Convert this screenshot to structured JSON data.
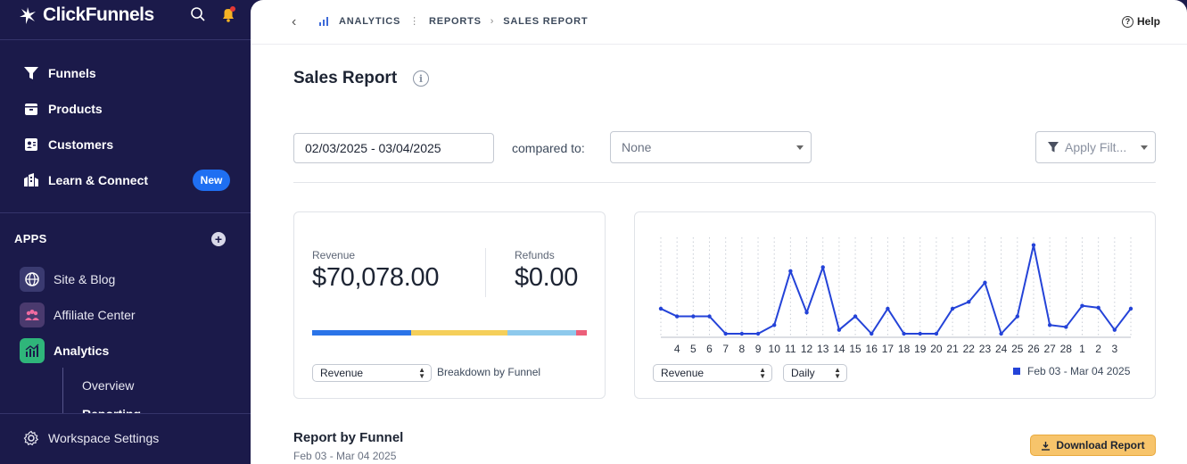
{
  "brand": {
    "name": "ClickFunnels"
  },
  "sidebar": {
    "nav": [
      {
        "label": "Funnels",
        "icon": "funnel-icon"
      },
      {
        "label": "Products",
        "icon": "box-icon"
      },
      {
        "label": "Customers",
        "icon": "contact-card-icon"
      },
      {
        "label": "Learn & Connect",
        "icon": "building-icon",
        "badge": "New"
      }
    ],
    "apps_label": "APPS",
    "apps": [
      {
        "label": "Site & Blog",
        "icon": "globe-icon",
        "color": "#3a3a70"
      },
      {
        "label": "Affiliate Center",
        "icon": "people-icon",
        "color": "#4a3a6e"
      },
      {
        "label": "Analytics",
        "icon": "chart-icon",
        "color": "#2fb57a"
      }
    ],
    "sub_items": [
      "Overview",
      "Reporting"
    ],
    "workspace_settings": "Workspace Settings"
  },
  "breadcrumb": {
    "items": [
      "ANALYTICS",
      "REPORTS",
      "SALES REPORT"
    ]
  },
  "help_label": "Help",
  "page_title": "Sales Report",
  "filters": {
    "date_range": "02/03/2025 - 03/04/2025",
    "compared_label": "compared to:",
    "compared_value": "None",
    "apply_filters": "Apply Filt..."
  },
  "summary": {
    "revenue_label": "Revenue",
    "revenue_value": "$70,078.00",
    "refunds_label": "Refunds",
    "refunds_value": "$0.00",
    "metric_select": "Revenue",
    "breakdown_label": "Breakdown by Funnel",
    "breakdown_bar": [
      {
        "share": 0.36,
        "color": "#2b74e8"
      },
      {
        "share": 0.35,
        "color": "#f5cf5a"
      },
      {
        "share": 0.25,
        "color": "#8ec9ec"
      },
      {
        "share": 0.04,
        "color": "#ec5f7a"
      }
    ]
  },
  "chart_data": {
    "type": "line",
    "x": [
      "3",
      "4",
      "5",
      "6",
      "7",
      "8",
      "9",
      "10",
      "11",
      "12",
      "13",
      "14",
      "15",
      "16",
      "17",
      "18",
      "19",
      "20",
      "21",
      "22",
      "23",
      "24",
      "25",
      "26",
      "27",
      "28",
      "1",
      "2",
      "3",
      "4"
    ],
    "tick_labels": [
      "",
      "4",
      "5",
      "6",
      "7",
      "8",
      "9",
      "10",
      "11",
      "12",
      "13",
      "14",
      "15",
      "16",
      "17",
      "18",
      "19",
      "20",
      "21",
      "22",
      "23",
      "24",
      "25",
      "26",
      "27",
      "28",
      "1",
      "2",
      "3",
      ""
    ],
    "series": [
      {
        "values": [
          0.26,
          0.18,
          0.18,
          0.18,
          0.0,
          0.0,
          0.0,
          0.09,
          0.65,
          0.22,
          0.69,
          0.04,
          0.18,
          0.0,
          0.26,
          0.0,
          0.0,
          0.0,
          0.26,
          0.33,
          0.53,
          0.0,
          0.18,
          0.92,
          0.09,
          0.07,
          0.29,
          0.27,
          0.04,
          0.26
        ],
        "color": "#2443d8"
      }
    ],
    "metric_select": "Revenue",
    "interval_select": "Daily",
    "legend": "Feb 03 - Mar 04 2025",
    "grid": "vertical dotted"
  },
  "report_by_funnel": {
    "title": "Report by Funnel",
    "subtitle": "Feb 03 - Mar 04 2025",
    "download_label": "Download Report"
  }
}
